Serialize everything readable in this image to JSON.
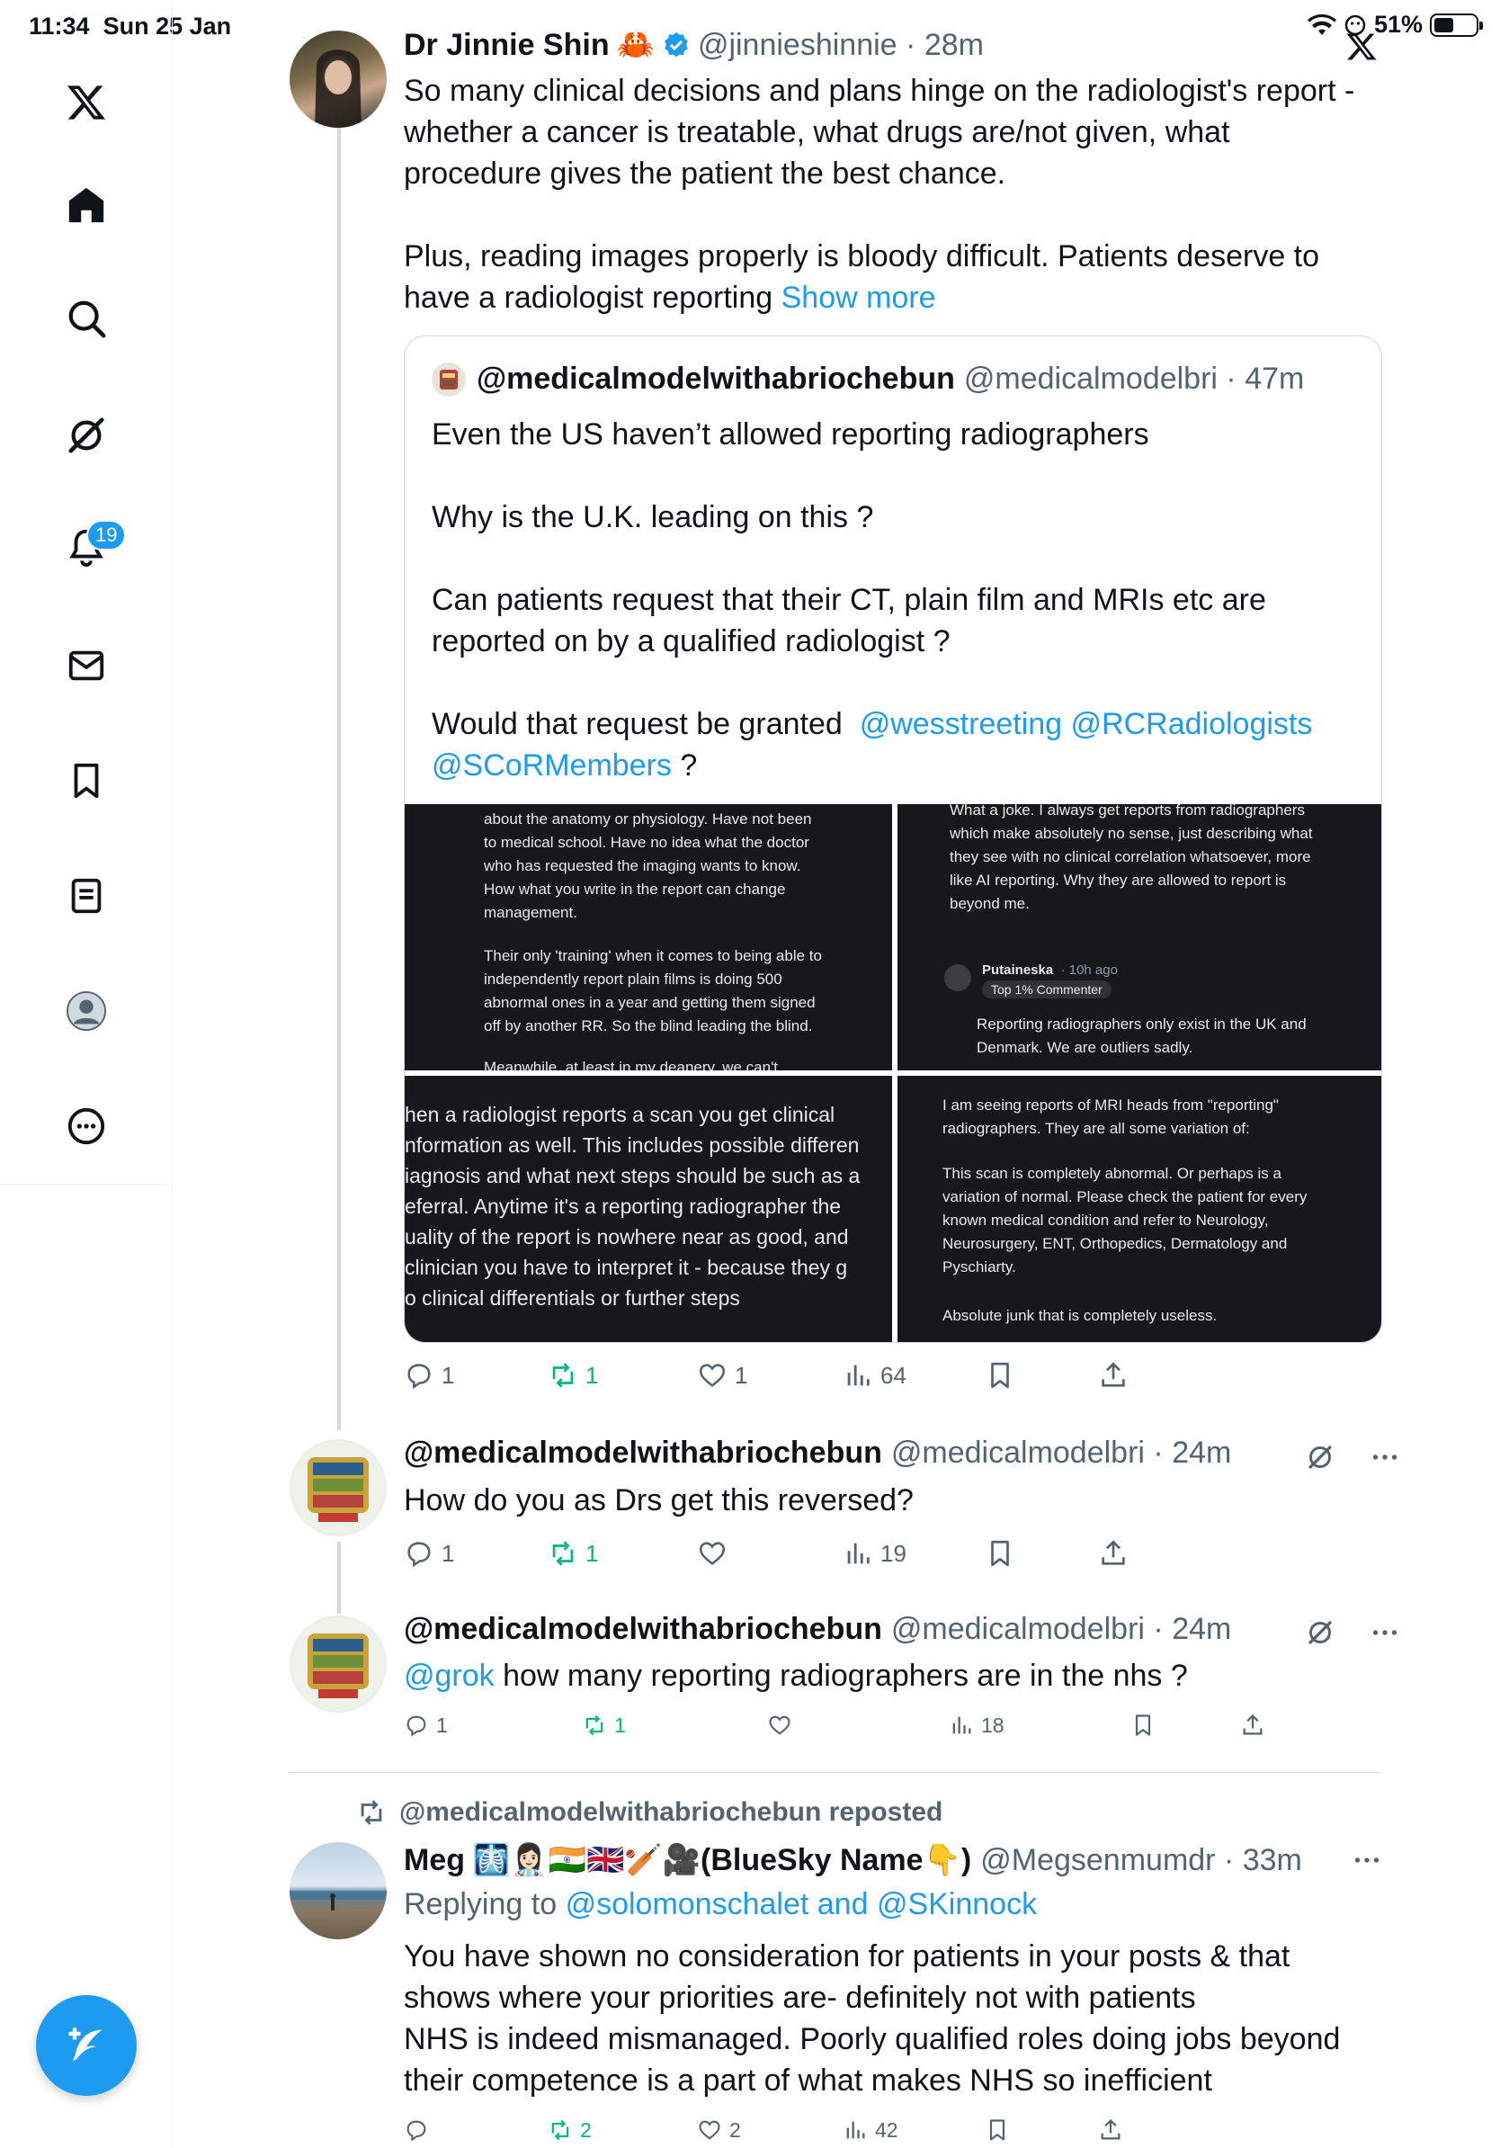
{
  "status_bar": {
    "time": "11:34",
    "date": "Sun 25 Jan",
    "battery": "51%"
  },
  "sidebar": {
    "notification_count": "19",
    "items": [
      "home",
      "explore",
      "grok",
      "notifications",
      "messages",
      "bookmarks",
      "lists",
      "profile",
      "more"
    ]
  },
  "tweet1": {
    "name": "Dr Jinnie Shin",
    "emoji": "🦀",
    "handle": "@jinnieshinnie",
    "time": "28m",
    "text_line1": "So many clinical decisions and plans hinge on the radiologist's report -",
    "text_line2": "whether a cancer is treatable, what drugs are/not given, what",
    "text_line3": "procedure gives the patient the best chance.",
    "text_line4": "Plus, reading images properly is bloody difficult. Patients deserve to",
    "text_line5": "have a radiologist reporting",
    "show_more": "Show more",
    "quote": {
      "name": "@medicalmodelwithabriochebun",
      "handle": "@medicalmodelbri",
      "time": "47m",
      "line1": "Even the US haven’t allowed reporting radiographers",
      "line2": "Why is the U.K. leading on this ?",
      "line3": "Can patients request that their CT, plain film and MRIs etc are",
      "line4": "reported on by a qualified radiologist ?",
      "line5": "Would that request be granted",
      "mention1": "@wesstreeting",
      "mention2": "@RCRadiologists",
      "mention3": "@SCoRMembers",
      "line6_end": " ?",
      "images": {
        "tl_1": "about the anatomy or physiology. Have not been",
        "tl_2": "to medical school. Have no idea what the doctor",
        "tl_3": "who has requested the imaging wants to know.",
        "tl_4": "How what you write in the report can change",
        "tl_5": "management.",
        "tl_6": "Their only 'training' when it comes to being able to",
        "tl_7": "independently report plain films is doing 500",
        "tl_8": "abnormal ones in a year and getting them signed",
        "tl_9": "off by another RR. So the blind leading the blind.",
        "tl_10": "Meanwhile, at least in my deanery, we can't",
        "tr_1": "What a joke. I always get reports from radiographers",
        "tr_2": "which make absolutely no sense, just describing what",
        "tr_3": "they see with no clinical correlation whatsoever, more",
        "tr_4": "like AI reporting. Why they are allowed to report is",
        "tr_5": "beyond me.",
        "tr_user": "Putaineska",
        "tr_time": "· 10h ago",
        "tr_badge": "Top 1% Commenter",
        "tr_6": "Reporting radiographers only exist in the UK and",
        "tr_7": "Denmark. We are outliers sadly.",
        "bl_1": "hen a radiologist reports a scan you get clinical",
        "bl_2": "nformation as well. This includes possible differen",
        "bl_3": "iagnosis and what next steps should be such as a",
        "bl_4": "eferral. Anytime it's a reporting radiographer the",
        "bl_5": "uality of the report is nowhere near as good, and",
        "bl_6": " clinician you have to interpret it - because they g",
        "bl_7": "o clinical differentials or further steps",
        "br_1": "I am seeing reports of MRI heads from \"reporting\"",
        "br_2": "radiographers. They are all some variation of:",
        "br_3": "This scan is completely abnormal. Or perhaps is a",
        "br_4": "variation of normal. Please check the patient for every",
        "br_5": "known medical condition and refer to Neurology,",
        "br_6": "Neurosurgery, ENT, Orthopedics, Dermatology and",
        "br_7": "Pyschiarty.",
        "br_8": "Absolute junk that is completely useless."
      }
    },
    "replies": "1",
    "reposts": "1",
    "likes": "1",
    "views": "64"
  },
  "tweet2": {
    "name": "@medicalmodelwithabriochebun",
    "handle": "@medicalmodelbri",
    "time": "24m",
    "text": "How do you as Drs get this reversed?",
    "replies": "1",
    "reposts": "1",
    "likes": "",
    "views": "19"
  },
  "tweet3": {
    "name": "@medicalmodelwithabriochebun",
    "handle": "@medicalmodelbri",
    "time": "24m",
    "mention": "@grok",
    "text": " how many reporting radiographers are in the nhs ?",
    "replies": "1",
    "reposts": "1",
    "likes": "",
    "views": "18"
  },
  "tweet4": {
    "repost_label": "@medicalmodelwithabriochebun reposted",
    "name": "Meg",
    "name_emoji": "🩻👩🏻‍⚕️🇮🇳🇬🇧🏏🎥",
    "name_suffix": "(BlueSky Name",
    "name_emoji2": "👇",
    "name_close": ")",
    "handle": "@Megsenmumdr",
    "time": "33m",
    "replying_prefix": "Replying to",
    "replying_to": "@solomonschalet and @SKinnock",
    "line1": "You have shown no consideration for patients in your posts & that",
    "line2": "shows where your priorities are- definitely not with patients",
    "line3": "NHS is indeed mismanaged. Poorly qualified roles doing jobs beyond",
    "line4": "their competence is a part of what makes NHS so inefficient",
    "replies": "",
    "reposts": "2",
    "likes": "2",
    "views": "42"
  },
  "colors": {
    "accent": "#1d9bf0",
    "repost": "#00ba7c",
    "muted": "#536471",
    "text": "#0f1419"
  }
}
